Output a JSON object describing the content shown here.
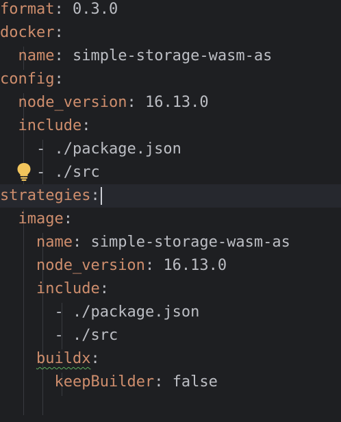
{
  "colors": {
    "background": "#1e1f22",
    "key": "#cf8e6d",
    "text": "#bcbec4",
    "current_line": "#26282e",
    "bulb": "#f2c55c"
  },
  "icons": {
    "intention": "lightbulb-icon"
  },
  "lines": [
    {
      "key": "format",
      "value": "0.3.0"
    },
    {
      "key": "docker",
      "value": ""
    },
    {
      "key": "name",
      "value": "simple-storage-wasm-as"
    },
    {
      "key": "config",
      "value": ""
    },
    {
      "key": "node_version",
      "value": "16.13.0"
    },
    {
      "key": "include",
      "value": ""
    },
    {
      "item": "./package.json"
    },
    {
      "item": "./src"
    },
    {
      "key": "strategies",
      "value": ""
    },
    {
      "key": "image",
      "value": ""
    },
    {
      "key": "name",
      "value": "simple-storage-wasm-as"
    },
    {
      "key": "node_version",
      "value": "16.13.0"
    },
    {
      "key": "include",
      "value": ""
    },
    {
      "item": "./package.json"
    },
    {
      "item": "./src"
    },
    {
      "key": "buildx",
      "value": ""
    },
    {
      "key": "keepBuilder",
      "value": "false"
    }
  ]
}
